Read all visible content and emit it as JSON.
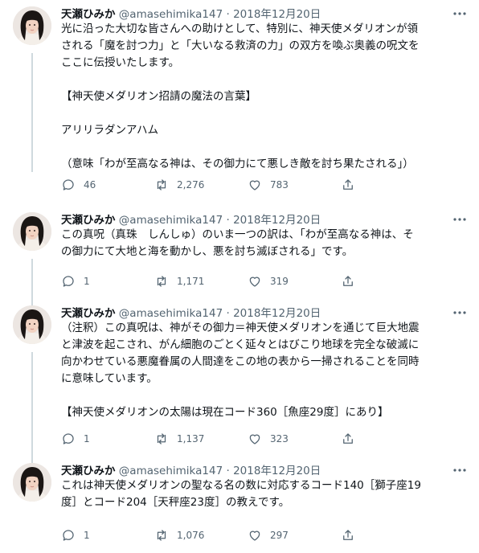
{
  "tweets": [
    {
      "name": "天瀬ひみか",
      "handle": "@amasehimika147",
      "separator": "·",
      "date": "2018年12月20日",
      "lines": [
        "光に沿った大切な皆さんへの助けとして、特別に、神天使メダリオンが領",
        "される「魔を討つ力」と「大いなる救済の力」の双方を喚ぶ奥義の呪文を",
        "ここに伝授いたします。",
        "",
        "【神天使メダリオン招請の魔法の言葉】",
        "",
        "アリリラダンアハム",
        "",
        "（意味「わが至高なる神は、その御力にて悪しき敵を討ち果たされる」）"
      ],
      "replies": "46",
      "retweets": "2,276",
      "likes": "783"
    },
    {
      "name": "天瀬ひみか",
      "handle": "@amasehimika147",
      "separator": "·",
      "date": "2018年12月20日",
      "lines": [
        "この真呪（真珠　しんしゅ）のいま一つの訳は、「わが至高なる神は、そ",
        "の御力にて大地と海を動かし、悪を討ち滅ぼされる」です。"
      ],
      "replies": "1",
      "retweets": "1,171",
      "likes": "319"
    },
    {
      "name": "天瀬ひみか",
      "handle": "@amasehimika147",
      "separator": "·",
      "date": "2018年12月20日",
      "lines": [
        "（注釈）この真呪は、神がその御力＝神天使メダリオンを通じて巨大地震",
        "と津波を起こされ、がん細胞のごとく延々とはびこり地球を完全な破滅に",
        "向かわせている悪魔眷属の人間達をこの地の表から一掃されることを同時",
        "に意味しています。",
        "",
        "【神天使メダリオンの太陽は現在コード360［魚座29度］にあり】"
      ],
      "replies": "1",
      "retweets": "1,137",
      "likes": "323"
    },
    {
      "name": "天瀬ひみか",
      "handle": "@amasehimika147",
      "separator": "·",
      "date": "2018年12月20日",
      "lines": [
        "これは神天使メダリオンの聖なる名の数に対応するコード140［獅子座19",
        "度］とコード204［天秤座23度］の教えです。"
      ],
      "replies": "1",
      "retweets": "1,076",
      "likes": "297"
    }
  ],
  "icons": {
    "more": "more-icon",
    "reply": "reply-icon",
    "retweet": "retweet-icon",
    "like": "like-icon",
    "share": "share-icon"
  },
  "colors": {
    "text": "#0f1419",
    "secondary": "#536471",
    "thread_line": "#cfd9de"
  }
}
